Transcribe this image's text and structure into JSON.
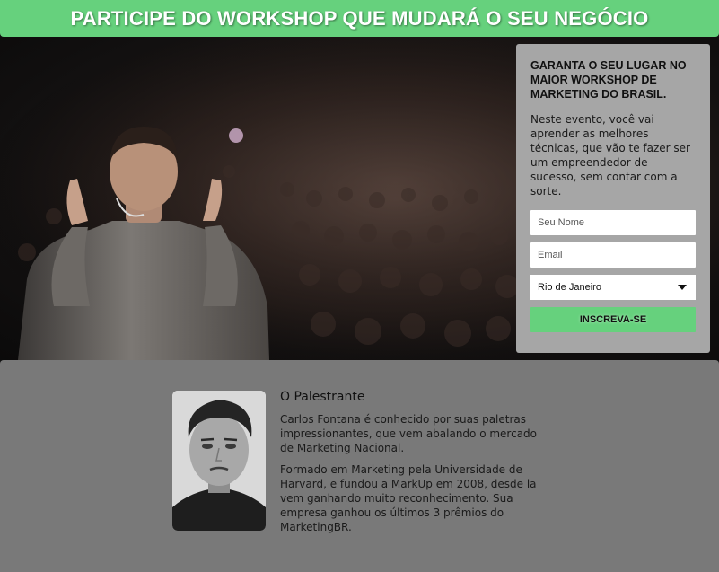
{
  "banner": {
    "title": "PARTICIPE DO WORKSHOP QUE MUDARÁ O SEU NEGÓCIO",
    "color": "#66d17d"
  },
  "hero": {
    "image": "speaker-on-stage-photo"
  },
  "form": {
    "title": "GARANTA O SEU LUGAR NO MAIOR WORKSHOP DE MARKETING DO BRASIL.",
    "description": "Neste evento, você vai aprender as melhores técnicas, que vão te fazer ser um empreendedor de sucesso, sem contar com a sorte.",
    "name_placeholder": "Seu Nome",
    "email_placeholder": "Email",
    "city_selected": "Rio de Janeiro",
    "submit_label": "INSCREVA-SE",
    "background": "#a6a6a6",
    "accent": "#66d17d"
  },
  "speaker": {
    "heading": "O Palestrante",
    "bio_1": "Carlos Fontana é conhecido por suas paletras impressionantes, que vem abalando o mercado de Marketing Nacional.",
    "bio_2": "Formado em Marketing pela Universidade de Harvard, e fundou a MarkUp em 2008, desde la vem ganhando muito reconhecimento. Sua empresa ganhou os últimos 3 prêmios do MarketingBR.",
    "photo": "speaker-portrait",
    "background": "#797979"
  }
}
